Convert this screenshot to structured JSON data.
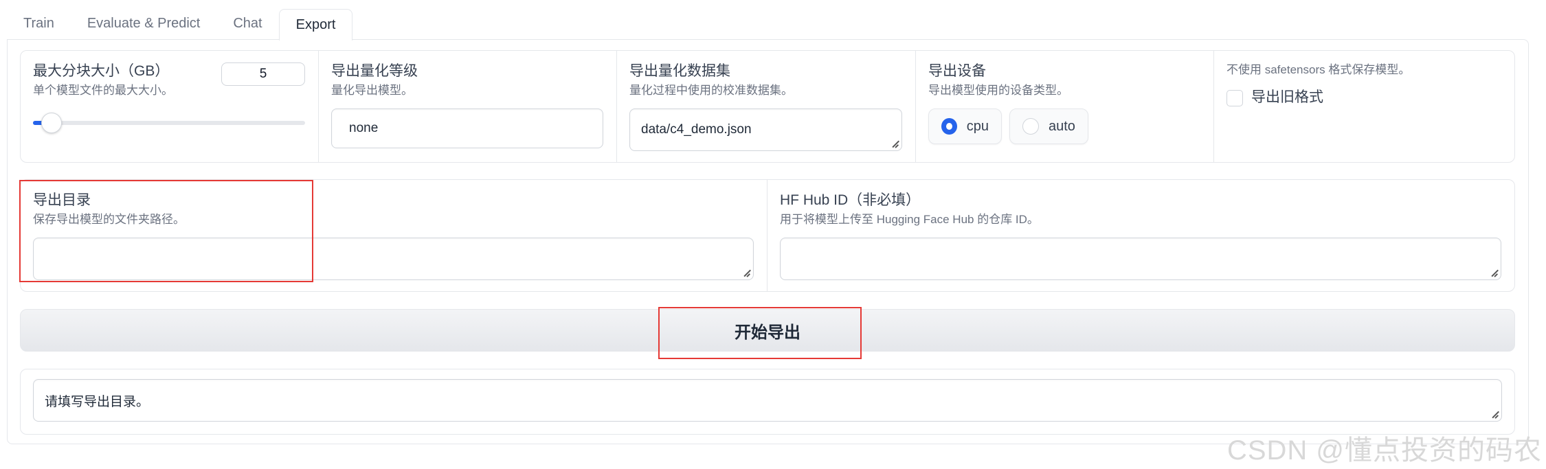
{
  "tabs": [
    {
      "label": "Train"
    },
    {
      "label": "Evaluate & Predict"
    },
    {
      "label": "Chat"
    },
    {
      "label": "Export"
    }
  ],
  "settings": {
    "max_shard": {
      "label": "最大分块大小（GB）",
      "info": "单个模型文件的最大大小。",
      "value": "5"
    },
    "quant_bit": {
      "label": "导出量化等级",
      "info": "量化导出模型。",
      "value": "none"
    },
    "quant_dataset": {
      "label": "导出量化数据集",
      "info": "量化过程中使用的校准数据集。",
      "value": "data/c4_demo.json"
    },
    "device": {
      "label": "导出设备",
      "info": "导出模型使用的设备类型。",
      "options": [
        "cpu",
        "auto"
      ],
      "selected": "cpu"
    },
    "legacy": {
      "info": "不使用 safetensors 格式保存模型。",
      "label": "导出旧格式"
    }
  },
  "export_dir": {
    "label": "导出目录",
    "info": "保存导出模型的文件夹路径。",
    "value": ""
  },
  "hub_id": {
    "label": "HF Hub ID（非必填）",
    "info": "用于将模型上传至 Hugging Face Hub 的仓库 ID。",
    "value": ""
  },
  "export_button": {
    "label": "开始导出"
  },
  "output": {
    "value": "请填写导出目录。"
  },
  "watermark": "CSDN @懂点投资的码农",
  "colors": {
    "accent": "#2563eb",
    "highlight": "#e53935"
  }
}
